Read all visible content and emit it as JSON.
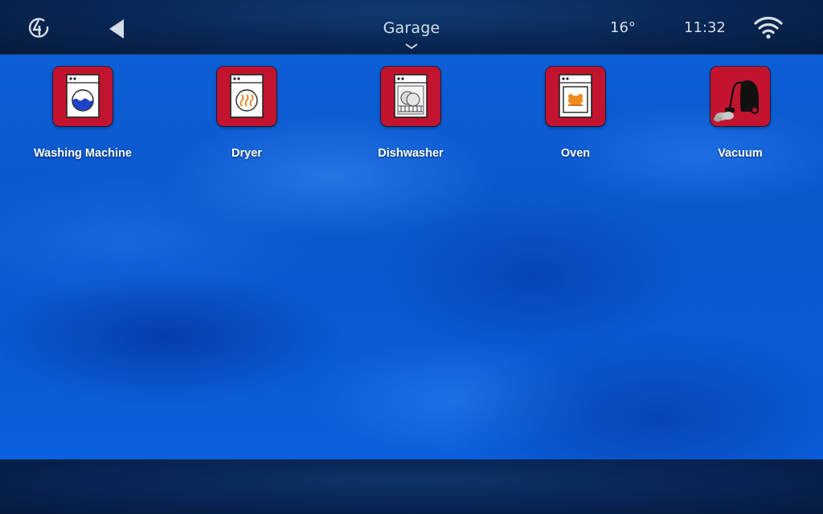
{
  "header": {
    "title": "Garage",
    "temperature": "16°",
    "time": "11:32",
    "icons": {
      "logo": "app-logo-icon",
      "back": "back-arrow-icon",
      "chevron": "chevron-down-icon",
      "wifi": "wifi-icon"
    }
  },
  "devices": [
    {
      "label": "Washing Machine",
      "icon": "washing-machine-icon"
    },
    {
      "label": "Dryer",
      "icon": "dryer-icon"
    },
    {
      "label": "Dishwasher",
      "icon": "dishwasher-icon"
    },
    {
      "label": "Oven",
      "icon": "oven-icon"
    },
    {
      "label": "Vacuum",
      "icon": "vacuum-icon"
    }
  ],
  "colors": {
    "tile_bg": "#c2142e",
    "main_bg": "#0b5fd9",
    "bar_bg": "#072453",
    "header_text": "#d7dde6"
  }
}
